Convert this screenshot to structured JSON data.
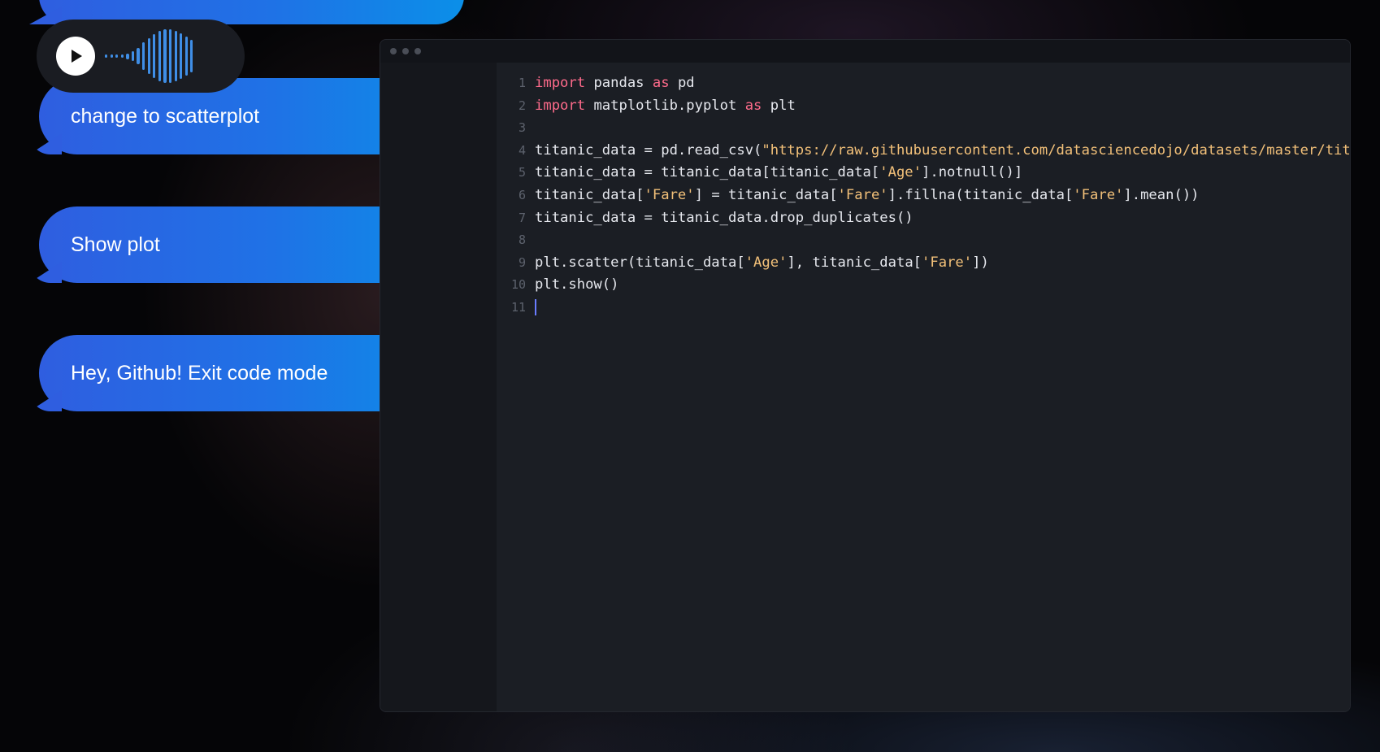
{
  "chat": {
    "voice_message": {
      "play_label": "play"
    },
    "messages": [
      {
        "text": "change to scatterplot"
      },
      {
        "text": "Show plot"
      },
      {
        "text": "Hey, Github! Exit code mode"
      }
    ]
  },
  "editor": {
    "lines": [
      {
        "num": "1",
        "tokens": [
          {
            "t": "import",
            "c": "kw"
          },
          {
            "t": " pandas ",
            "c": ""
          },
          {
            "t": "as",
            "c": "kw"
          },
          {
            "t": " pd",
            "c": ""
          }
        ]
      },
      {
        "num": "2",
        "tokens": [
          {
            "t": "import",
            "c": "kw"
          },
          {
            "t": " matplotlib.pyplot ",
            "c": ""
          },
          {
            "t": "as",
            "c": "kw"
          },
          {
            "t": " plt",
            "c": ""
          }
        ]
      },
      {
        "num": "3",
        "tokens": []
      },
      {
        "num": "4",
        "tokens": [
          {
            "t": "titanic_data = pd.read_csv(",
            "c": ""
          },
          {
            "t": "\"https://raw.githubusercontent.com/datasciencedojo/datasets/master/titanic",
            "c": "str"
          }
        ]
      },
      {
        "num": "5",
        "tokens": [
          {
            "t": "titanic_data = titanic_data[titanic_data[",
            "c": ""
          },
          {
            "t": "'Age'",
            "c": "str"
          },
          {
            "t": "].notnull()]",
            "c": ""
          }
        ]
      },
      {
        "num": "6",
        "tokens": [
          {
            "t": "titanic_data[",
            "c": ""
          },
          {
            "t": "'Fare'",
            "c": "str"
          },
          {
            "t": "] = titanic_data[",
            "c": ""
          },
          {
            "t": "'Fare'",
            "c": "str"
          },
          {
            "t": "].fillna(titanic_data[",
            "c": ""
          },
          {
            "t": "'Fare'",
            "c": "str"
          },
          {
            "t": "].mean())",
            "c": ""
          }
        ]
      },
      {
        "num": "7",
        "tokens": [
          {
            "t": "titanic_data = titanic_data.drop_duplicates()",
            "c": ""
          }
        ]
      },
      {
        "num": "8",
        "tokens": []
      },
      {
        "num": "9",
        "tokens": [
          {
            "t": "plt.scatter(titanic_data[",
            "c": ""
          },
          {
            "t": "'Age'",
            "c": "str"
          },
          {
            "t": "], titanic_data[",
            "c": ""
          },
          {
            "t": "'Fare'",
            "c": "str"
          },
          {
            "t": "])",
            "c": ""
          }
        ]
      },
      {
        "num": "10",
        "tokens": [
          {
            "t": "plt.show()",
            "c": ""
          }
        ]
      },
      {
        "num": "11",
        "tokens": [],
        "cursor": true
      }
    ]
  },
  "colors": {
    "bubble_start": "#2f5ee0",
    "bubble_end": "#0b8fe8",
    "keyword": "#ff6b8b",
    "string": "#f2c079",
    "code_text": "#e6e8ee",
    "line_number": "#5d626d",
    "cursor": "#6a7cff"
  },
  "icons": {
    "play": "play-icon",
    "waveform": "waveform-icon",
    "window_dots": "window-dots-icon"
  }
}
